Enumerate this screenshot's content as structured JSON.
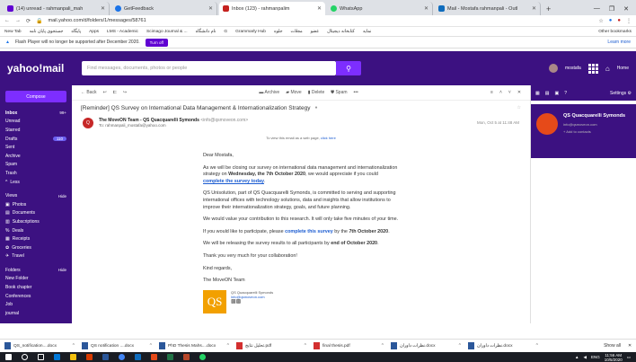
{
  "browser": {
    "tabs": [
      {
        "label": "(14) unread - rahmanpali_mah",
        "active": false,
        "color": "#6001d2"
      },
      {
        "label": "GetFeedback",
        "active": false,
        "color": "#1a73e8"
      },
      {
        "label": "Inbox (123) - rahmanpalim",
        "active": true,
        "color": "#c5221f"
      },
      {
        "label": "WhatsApp",
        "active": false,
        "color": "#25d366"
      },
      {
        "label": "Mail - Mostafa rahmanpali - Outl",
        "active": false,
        "color": "#0f6cbd"
      }
    ],
    "new_tab": "+",
    "window_controls": [
      "—",
      "❐",
      "✕"
    ],
    "address": "mail.yahoo.com/d/folders/1/messages/58761",
    "bookmarks": [
      "New Tab",
      "جستجوی پایان نامه",
      "پایگاه",
      "Apps",
      "LMS - Academic",
      "Scimago Journal & ...",
      "نام دانشگاه",
      "G",
      "Grammarly Hub",
      "جلوه",
      "مجلات",
      "عضو",
      "کتابخانه دیجیتال",
      "نمایه",
      "عضو",
      "نمایه"
    ],
    "bookmarks_right": "Other bookmarks",
    "infobar": {
      "text": "Flash Player will no longer be supported after December 2020.",
      "button": "Turn off",
      "right": "Learn more"
    }
  },
  "yahoo": {
    "logo": "yahoo!mail",
    "search_placeholder": "Find messages, documents, photos or people",
    "user_name": "mostafa",
    "home": "Home"
  },
  "sidebar": {
    "compose": "Compose",
    "folders": [
      {
        "label": "Inbox",
        "count": "99+"
      },
      {
        "label": "Unread",
        "count": ""
      },
      {
        "label": "Starred",
        "count": ""
      },
      {
        "label": "Drafts",
        "count": "110"
      },
      {
        "label": "Sent",
        "count": ""
      },
      {
        "label": "Archive",
        "count": ""
      },
      {
        "label": "Spam",
        "count": ""
      },
      {
        "label": "Trash",
        "count": ""
      },
      {
        "label": "Less",
        "count": ""
      }
    ],
    "views_head": "Views",
    "views_hide": "Hide",
    "views": [
      "Photos",
      "Documents",
      "Subscriptions",
      "Deals",
      "Receipts",
      "Groceries",
      "Travel"
    ],
    "folders_head": "Folders",
    "folders_hide": "Hide",
    "user_folders": [
      "New Folder",
      "Book chapter",
      "Conferences",
      "Job",
      "journal"
    ]
  },
  "toolbar": {
    "back": "Back",
    "archive": "Archive",
    "move": "Move",
    "delete": "Delete",
    "spam": "Spam",
    "more": "•••"
  },
  "message": {
    "subject": "[Reminder] QS Survey on International Data Management & Internationalization Strategy",
    "sender_name": "The MoveON Team - QS Quacquarelli Symonds",
    "sender_email": "<info@qsmoveon.com>",
    "to": "To: rahmanpali_mostafa@yahoo.com",
    "date": "Mon, Oct 5 at 11:48 AM",
    "view_web_text": "To view this email as a web page,",
    "view_web_link": "click here",
    "greeting": "Dear Mostafa,",
    "p1a": "As we will be closing our survey on international data management and internationalization strategy on",
    "p1b": "Wednesday, the 7th October 2020",
    "p1c": ", we would appreciate if you could",
    "p1link": "complete the survey today",
    "p2": "QS Unisolution, part of QS Quacquarelli Symonds, is committed to serving and supporting international offices with technology solutions, data and insights that allow institutions to improve their internationalization strategy, goals, and future planning.",
    "p3": "We would value your contribution to this research. It will only take five minutes of your time.",
    "p4a": "If you would like to participate, please",
    "p4link": "complete this survey",
    "p4b": "by the",
    "p4c": "7th October 2020",
    "p5a": "We will be releasing the survey results to all participants by",
    "p5b": "end of October 2020",
    "p6": "Thank you very much for your collaboration!",
    "p7": "Kind regards,",
    "p8": "The MoveON Team",
    "sig_logo": "QS",
    "sig_name": "QS Quacquarelli Symonds",
    "sig_email": "info@qsmoveon.com"
  },
  "rightpane": {
    "settings": "Settings",
    "contact_name": "QS Quacquarelli Symonds",
    "contact_email": "info@qsmoveon.com",
    "contact_action": "+ Add to contacts"
  },
  "downloads": [
    "QS_notification....docx",
    "QS notification ....docx",
    "PhD Thesis Mahs....docx",
    "تحلیل نتایج.pdf",
    "final thesis.pdf",
    "نظرات داوران.docx",
    "نظرات داوران.docx"
  ],
  "show_all": "Show all",
  "taskbar": {
    "time": "11:56 AM",
    "date": "10/5/2020",
    "lang": "ENG"
  }
}
